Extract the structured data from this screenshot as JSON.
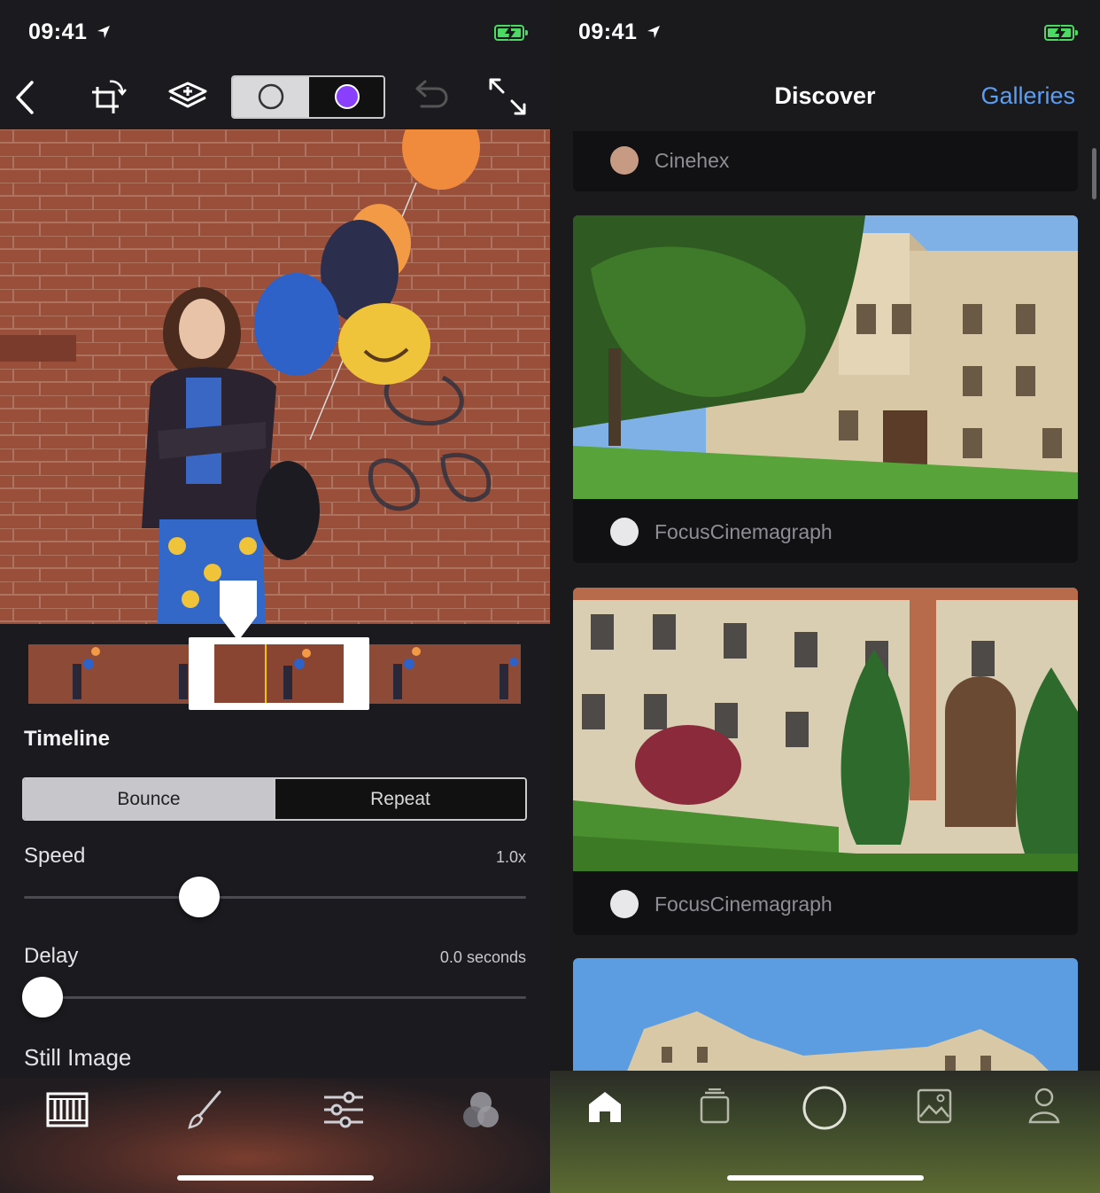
{
  "left": {
    "status": {
      "time": "09:41"
    },
    "timeline": {
      "title": "Timeline",
      "modes": [
        "Bounce",
        "Repeat"
      ],
      "active_mode": "Bounce"
    },
    "speed": {
      "label": "Speed",
      "value": "1.0x",
      "level": 0.35
    },
    "delay": {
      "label": "Delay",
      "value": "0.0 seconds",
      "level": 0.0
    },
    "still_image": {
      "label": "Still Image"
    },
    "colors": {
      "accent": "#8a3ffc",
      "playhead": "#f5c300"
    }
  },
  "right": {
    "status": {
      "time": "09:41"
    },
    "nav": {
      "title": "Discover",
      "galleries": "Galleries"
    },
    "feed": [
      {
        "author": "Cinehex"
      },
      {
        "author": "FocusCinemagraph"
      },
      {
        "author": "FocusCinemagraph"
      }
    ],
    "colors": {
      "link": "#5b9ef5"
    }
  }
}
